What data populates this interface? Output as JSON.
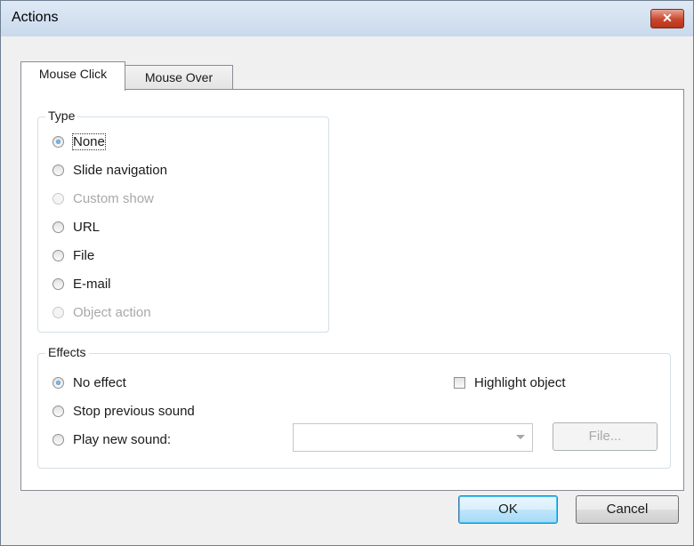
{
  "window": {
    "title": "Actions",
    "close_glyph": "✕"
  },
  "tabs": [
    {
      "label": "Mouse Click",
      "active": true
    },
    {
      "label": "Mouse Over",
      "active": false
    }
  ],
  "type_group": {
    "label": "Type",
    "options": [
      {
        "label": "None",
        "checked": true,
        "disabled": false
      },
      {
        "label": "Slide navigation",
        "checked": false,
        "disabled": false
      },
      {
        "label": "Custom show",
        "checked": false,
        "disabled": true
      },
      {
        "label": "URL",
        "checked": false,
        "disabled": false
      },
      {
        "label": "File",
        "checked": false,
        "disabled": false
      },
      {
        "label": "E-mail",
        "checked": false,
        "disabled": false
      },
      {
        "label": "Object action",
        "checked": false,
        "disabled": true
      }
    ]
  },
  "effects_group": {
    "label": "Effects",
    "options": [
      {
        "label": "No effect",
        "checked": true
      },
      {
        "label": "Stop previous sound",
        "checked": false
      },
      {
        "label": "Play new sound:",
        "checked": false
      }
    ],
    "highlight_label": "Highlight object",
    "highlight_checked": false,
    "sound_value": "",
    "file_button": "File..."
  },
  "footer": {
    "ok": "OK",
    "cancel": "Cancel"
  },
  "colors": {
    "accent": "#2a7bc4",
    "title_bar": "#c9d9ec",
    "close": "#c9462c"
  }
}
